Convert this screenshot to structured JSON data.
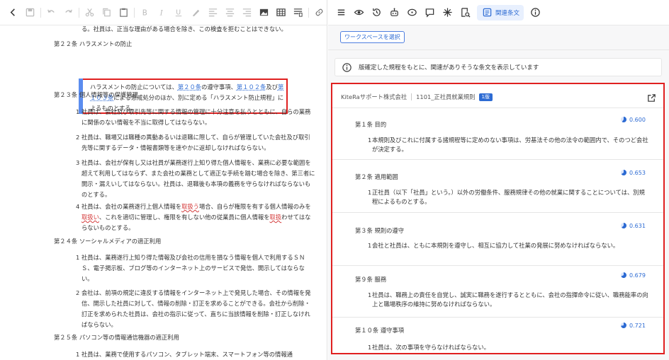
{
  "colors": {
    "accent": "#2d6bd3",
    "highlight_border": "#e02020",
    "error_underline": "#d43b3b"
  },
  "left_toolbar": {
    "icons": [
      "back-icon",
      "save-icon",
      "undo-icon",
      "redo-icon",
      "cut-icon",
      "copy-icon",
      "paste-icon",
      "bold-icon",
      "italic-icon",
      "underline-icon",
      "format-paint-icon",
      "align-left-icon",
      "align-center-icon",
      "align-right-icon",
      "image-icon",
      "table-icon",
      "list-icon",
      "link-icon",
      "insert-ref-icon",
      "clear-ref-icon",
      "pin-icon"
    ]
  },
  "document": {
    "top_fragment": "る。社員は、正当な理由がある場合を除き、この検査を拒むことはできない。",
    "art22": {
      "heading": "第２２条  ハラスメントの防止",
      "t1": "ハラスメントの防止については、",
      "l1": "第２０条",
      "t2": "の遵守事項、",
      "l2": "第１０２条",
      "t3": "及び",
      "l3": "第１０３条",
      "t4": "による懲戒処分のほか、別に定める「ハラスメント防止規程」によるものとする。"
    },
    "art23": {
      "heading": "第２３条  個人情報等の保護管理",
      "p1_num": "1",
      "p1": "社員は、会社及び取引先等に関する情報の管理に十分注意を払うとともに、自らの業務に関係のない情報を不当に取得してはならない。",
      "p2_num": "2",
      "p2": "社員は、職場又は職種の異動あるいは退職に際して、自らが管理していた会社及び取引先等に関するデータ・情報書類等を速やかに返却しなければならない。",
      "p3_num": "3",
      "p3": "社員は、会社が保有し又は社員が業務遂行上知り得た個人情報を、業務に必要な範囲を超えて利用してはならず、また会社の業務として適正な手続を踏む場合を除き、第三者に開示・漏えいしてはならない。社員は、退職後も本項の義務を守らなければならないものとする。",
      "p4_num": "4",
      "p4a": "社員は、会社の業務遂行上個人情報を",
      "p4w1": "取扱う",
      "p4b": "場合、自らが権限を有する個人情報のみを",
      "p4w2": "取扱い",
      "p4c": "、これを適切に管理し、権限を有しない他の従業員に個人情報を",
      "p4w3": "取扱",
      "p4d": "わせてはならないものとする。"
    },
    "art24": {
      "heading": "第２４条  ソーシャルメディアの適正利用",
      "p1_num": "1",
      "p1": "社員は、業務遂行上知り得た情報及び会社の信用を損なう情報を個人で利用するＳＮＳ、電子掲示板、ブログ等のインターネット上のサービスで発信、開示してはならない。",
      "p2_num": "2",
      "p2": "会社は、前項の規定に違反する情報をインターネット上で発見した場合、その情報を発信、開示した社員に対して、情報の削除・訂正を求めることができる。会社から削除・訂正を求められた社員は、会社の指示に従って、直ちに当該情報を削除・訂正しなければならない。"
    },
    "art25": {
      "heading": "第２５条  パソコン等の情報通信機器の適正利用",
      "p1_num": "1",
      "p1": "社員は、業務で使用するパソコン、タブレット端末、スマートフォン等の情報通"
    }
  },
  "right_toolbar": {
    "icons": [
      "menu-icon",
      "eye-icon",
      "history-icon",
      "robot-icon",
      "chat-bubble-icon",
      "comment-icon",
      "sparkle-icon",
      "document-search-icon"
    ],
    "active_tab_label": "関連条文",
    "info_icon": "info-icon"
  },
  "panel": {
    "workspace_button": "ワークスペースを選択",
    "banner": "版確定した規程をもとに、関連がありそうな条文を表示しています",
    "company": "KiteRaサポート株式会社",
    "rule": "1101_正社員就業規則",
    "version": "1版",
    "articles": [
      {
        "title": "第１条  目的",
        "score": "0.600",
        "score_fraction": 0.6,
        "num": "1",
        "body": "本規則及びこれに付属する諸規程等に定めのない事項は、労基法その他の法令の範囲内で、そのつど会社が決定する。"
      },
      {
        "title": "第２条  適用範囲",
        "score": "0.653",
        "score_fraction": 0.653,
        "num": "1",
        "body": "正社員（以下「社員」という。）以外の労働条件、服務規律その他の就業に関することについては、別規程によるものとする。"
      },
      {
        "title": "第３条  規則の遵守",
        "score": "0.631",
        "score_fraction": 0.631,
        "num": "1",
        "body": "会社と社員は、ともに本規則を遵守し、相互に協力して社業の発展に努めなければならない。"
      },
      {
        "title": "第９条  服務",
        "score": "0.679",
        "score_fraction": 0.679,
        "num": "1",
        "body": "社員は、職務上の責任を自覚し、誠実に職務を遂行するとともに、会社の指揮命令に従い、職務能率の向上と職場秩序の維持に努めなければならない。"
      },
      {
        "title": "第１０条  遵守事項",
        "score": "0.721",
        "score_fraction": 0.721,
        "num": "1",
        "body": "社員は、次の事項を守らなければならない。"
      }
    ]
  }
}
